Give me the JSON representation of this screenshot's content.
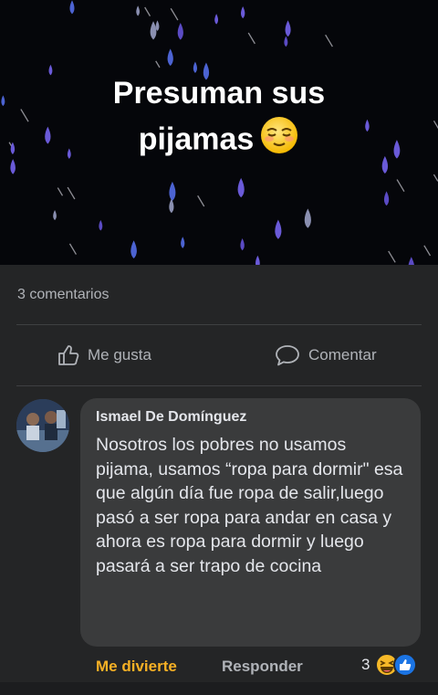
{
  "post": {
    "text": "Presuman sus pijamas",
    "emoji": "relieved-face-emoji",
    "background": "#05060a"
  },
  "stats": {
    "comments": "3 comentarios"
  },
  "actions": {
    "like": "Me gusta",
    "comment": "Comentar"
  },
  "comment": {
    "author": "Ismael De Domínguez",
    "text": "Nosotros los pobres no usamos pijama, usamos “ropa para dormir\" esa que algún día fue ropa de salir,luego pasó a ser ropa para andar en casa y ahora es ropa para dormir y luego pasará a ser trapo de cocina",
    "reaction_label": "Me divierte",
    "reply_label": "Responder",
    "reaction_count": "3",
    "reaction_icons": [
      "haha-icon",
      "like-icon"
    ]
  },
  "colors": {
    "accent_reaction": "#f7b125",
    "text_primary": "#e4e6eb",
    "text_secondary": "#b0b3b8",
    "surface": "#242526",
    "bubble": "#3a3b3c"
  }
}
